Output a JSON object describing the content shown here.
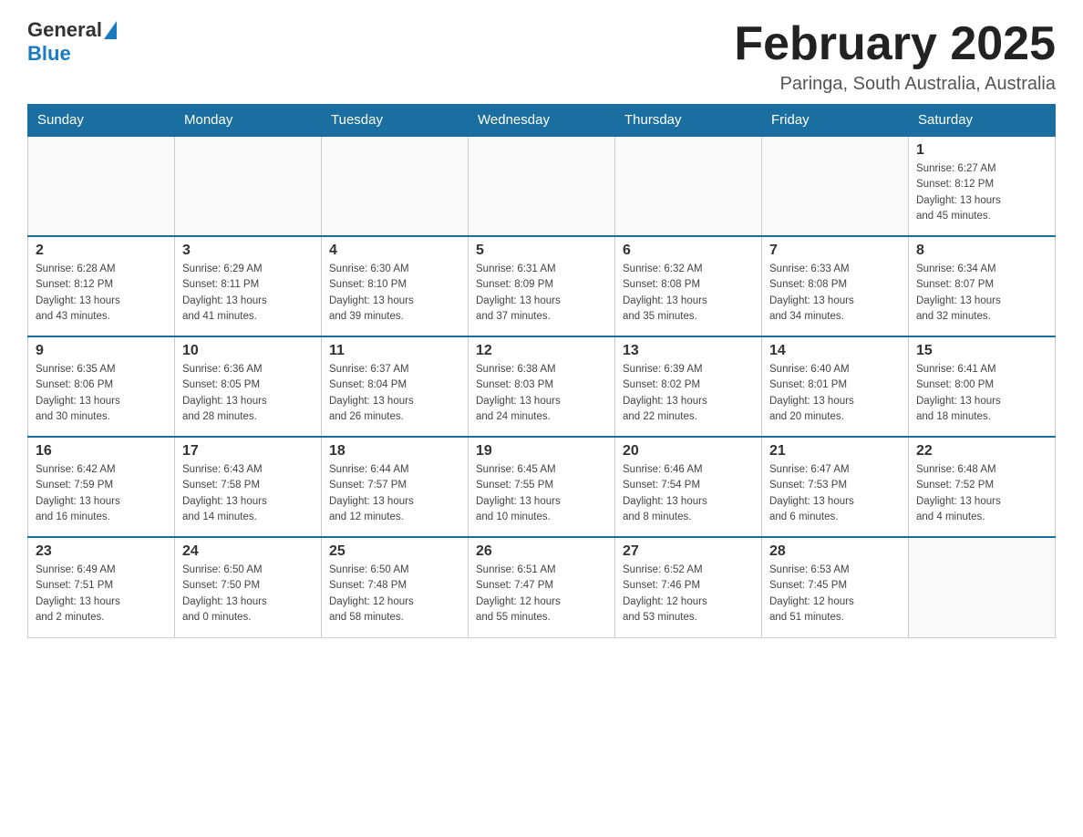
{
  "header": {
    "logo_text_general": "General",
    "logo_text_blue": "Blue",
    "title": "February 2025",
    "subtitle": "Paringa, South Australia, Australia"
  },
  "days_of_week": [
    "Sunday",
    "Monday",
    "Tuesday",
    "Wednesday",
    "Thursday",
    "Friday",
    "Saturday"
  ],
  "weeks": [
    [
      {
        "day": "",
        "info": ""
      },
      {
        "day": "",
        "info": ""
      },
      {
        "day": "",
        "info": ""
      },
      {
        "day": "",
        "info": ""
      },
      {
        "day": "",
        "info": ""
      },
      {
        "day": "",
        "info": ""
      },
      {
        "day": "1",
        "info": "Sunrise: 6:27 AM\nSunset: 8:12 PM\nDaylight: 13 hours\nand 45 minutes."
      }
    ],
    [
      {
        "day": "2",
        "info": "Sunrise: 6:28 AM\nSunset: 8:12 PM\nDaylight: 13 hours\nand 43 minutes."
      },
      {
        "day": "3",
        "info": "Sunrise: 6:29 AM\nSunset: 8:11 PM\nDaylight: 13 hours\nand 41 minutes."
      },
      {
        "day": "4",
        "info": "Sunrise: 6:30 AM\nSunset: 8:10 PM\nDaylight: 13 hours\nand 39 minutes."
      },
      {
        "day": "5",
        "info": "Sunrise: 6:31 AM\nSunset: 8:09 PM\nDaylight: 13 hours\nand 37 minutes."
      },
      {
        "day": "6",
        "info": "Sunrise: 6:32 AM\nSunset: 8:08 PM\nDaylight: 13 hours\nand 35 minutes."
      },
      {
        "day": "7",
        "info": "Sunrise: 6:33 AM\nSunset: 8:08 PM\nDaylight: 13 hours\nand 34 minutes."
      },
      {
        "day": "8",
        "info": "Sunrise: 6:34 AM\nSunset: 8:07 PM\nDaylight: 13 hours\nand 32 minutes."
      }
    ],
    [
      {
        "day": "9",
        "info": "Sunrise: 6:35 AM\nSunset: 8:06 PM\nDaylight: 13 hours\nand 30 minutes."
      },
      {
        "day": "10",
        "info": "Sunrise: 6:36 AM\nSunset: 8:05 PM\nDaylight: 13 hours\nand 28 minutes."
      },
      {
        "day": "11",
        "info": "Sunrise: 6:37 AM\nSunset: 8:04 PM\nDaylight: 13 hours\nand 26 minutes."
      },
      {
        "day": "12",
        "info": "Sunrise: 6:38 AM\nSunset: 8:03 PM\nDaylight: 13 hours\nand 24 minutes."
      },
      {
        "day": "13",
        "info": "Sunrise: 6:39 AM\nSunset: 8:02 PM\nDaylight: 13 hours\nand 22 minutes."
      },
      {
        "day": "14",
        "info": "Sunrise: 6:40 AM\nSunset: 8:01 PM\nDaylight: 13 hours\nand 20 minutes."
      },
      {
        "day": "15",
        "info": "Sunrise: 6:41 AM\nSunset: 8:00 PM\nDaylight: 13 hours\nand 18 minutes."
      }
    ],
    [
      {
        "day": "16",
        "info": "Sunrise: 6:42 AM\nSunset: 7:59 PM\nDaylight: 13 hours\nand 16 minutes."
      },
      {
        "day": "17",
        "info": "Sunrise: 6:43 AM\nSunset: 7:58 PM\nDaylight: 13 hours\nand 14 minutes."
      },
      {
        "day": "18",
        "info": "Sunrise: 6:44 AM\nSunset: 7:57 PM\nDaylight: 13 hours\nand 12 minutes."
      },
      {
        "day": "19",
        "info": "Sunrise: 6:45 AM\nSunset: 7:55 PM\nDaylight: 13 hours\nand 10 minutes."
      },
      {
        "day": "20",
        "info": "Sunrise: 6:46 AM\nSunset: 7:54 PM\nDaylight: 13 hours\nand 8 minutes."
      },
      {
        "day": "21",
        "info": "Sunrise: 6:47 AM\nSunset: 7:53 PM\nDaylight: 13 hours\nand 6 minutes."
      },
      {
        "day": "22",
        "info": "Sunrise: 6:48 AM\nSunset: 7:52 PM\nDaylight: 13 hours\nand 4 minutes."
      }
    ],
    [
      {
        "day": "23",
        "info": "Sunrise: 6:49 AM\nSunset: 7:51 PM\nDaylight: 13 hours\nand 2 minutes."
      },
      {
        "day": "24",
        "info": "Sunrise: 6:50 AM\nSunset: 7:50 PM\nDaylight: 13 hours\nand 0 minutes."
      },
      {
        "day": "25",
        "info": "Sunrise: 6:50 AM\nSunset: 7:48 PM\nDaylight: 12 hours\nand 58 minutes."
      },
      {
        "day": "26",
        "info": "Sunrise: 6:51 AM\nSunset: 7:47 PM\nDaylight: 12 hours\nand 55 minutes."
      },
      {
        "day": "27",
        "info": "Sunrise: 6:52 AM\nSunset: 7:46 PM\nDaylight: 12 hours\nand 53 minutes."
      },
      {
        "day": "28",
        "info": "Sunrise: 6:53 AM\nSunset: 7:45 PM\nDaylight: 12 hours\nand 51 minutes."
      },
      {
        "day": "",
        "info": ""
      }
    ]
  ]
}
